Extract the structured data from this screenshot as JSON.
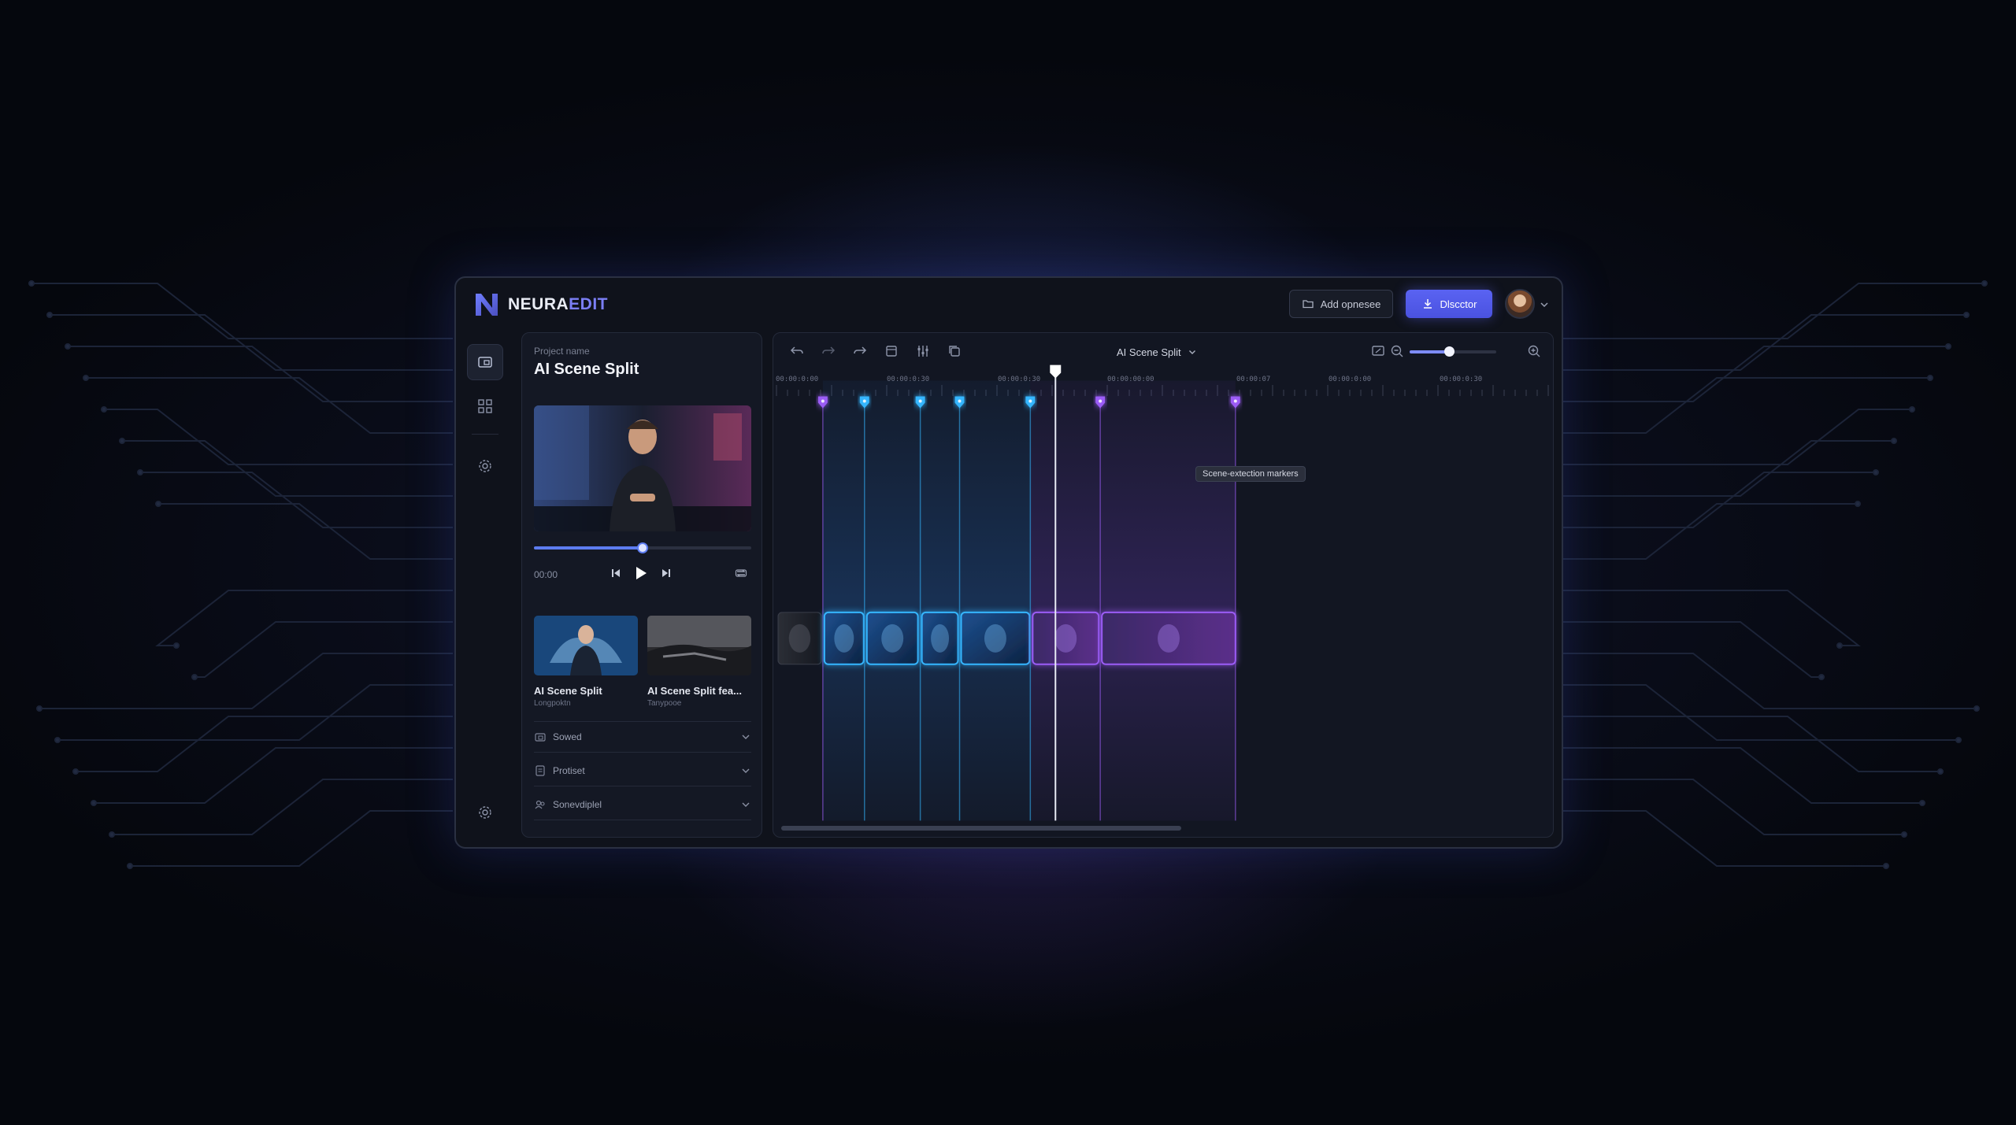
{
  "app": {
    "logo_primary": "NEURA",
    "logo_accent": "EDIT"
  },
  "header": {
    "secondary_button": "Add opnesee",
    "primary_button": "Dlscctor",
    "accent_color": "#5a63f2"
  },
  "sidebar_rail": {
    "items": [
      {
        "icon": "folder-icon",
        "active": true
      },
      {
        "icon": "grid-icon",
        "active": false
      },
      {
        "icon": "settings-icon",
        "active": false
      }
    ],
    "footer_icon": "settings-icon"
  },
  "project": {
    "label": "Project name",
    "title": "AI Scene Split"
  },
  "player": {
    "time": "00:00",
    "progress": 0.5
  },
  "thumbnails": [
    {
      "title": "AI Scene Split",
      "subtitle": "Longpoktn"
    },
    {
      "title": "AI Scene Split fea...",
      "subtitle": "Tanypooe"
    }
  ],
  "accordion": [
    {
      "label": "Sowed",
      "icon": "folder-icon"
    },
    {
      "label": "Protiset",
      "icon": "document-icon"
    },
    {
      "label": "Sonevdiplel",
      "icon": "people-icon"
    }
  ],
  "timeline": {
    "sequence": "AI Scene Split",
    "zoom_level": 0.45,
    "ruler_ticks": [
      "00:00:0:00",
      "00:00:0:30",
      "00:00:0:30",
      "00:00:00:00",
      "00:00:07",
      "00:00:0:00",
      "00:00:0:30"
    ],
    "tooltip": "Scene-extection markers",
    "marker_colors": {
      "blue": "#35b6ff",
      "purple": "#9b5cf6"
    },
    "markers": [
      {
        "color": "purple"
      },
      {
        "color": "blue"
      },
      {
        "color": "blue"
      },
      {
        "color": "blue"
      },
      {
        "color": "blue"
      },
      {
        "color": "purple"
      },
      {
        "color": "purple"
      }
    ],
    "clips": [
      {
        "name": "clip-1",
        "tone": "neutral"
      },
      {
        "name": "clip-2",
        "tone": "blue"
      },
      {
        "name": "clip-3",
        "tone": "blue"
      },
      {
        "name": "clip-4",
        "tone": "blue"
      },
      {
        "name": "clip-5",
        "tone": "blue"
      },
      {
        "name": "clip-6",
        "tone": "purple"
      },
      {
        "name": "clip-7",
        "tone": "purple"
      }
    ]
  }
}
